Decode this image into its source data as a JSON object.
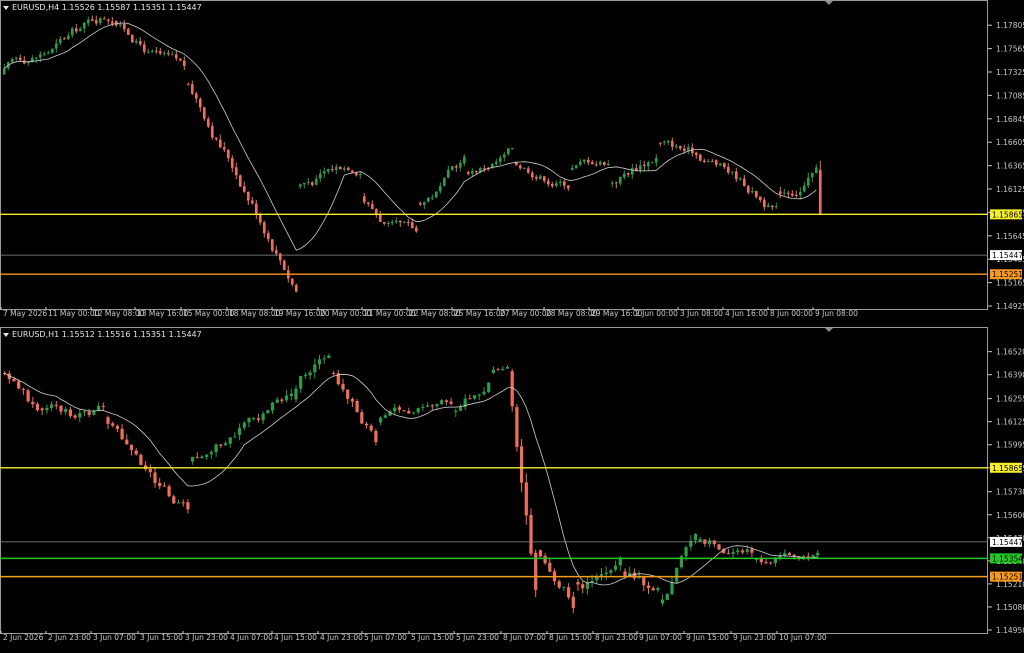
{
  "colors": {
    "bull": "#2e9c4a",
    "bear": "#ef6f5e",
    "ma": "#cfcfcf",
    "yellow_line": "#f5ef2a",
    "orange_line": "#f59a1e",
    "green_line": "#22c822",
    "bid_line": "#8e8e8e",
    "axis": "#c8c8c8"
  },
  "charts": [
    {
      "id": "h4",
      "title": "EURUSD,H4  1.15526 1.15587 1.15351 1.15447",
      "ylim": [
        1.14925,
        1.1792
      ],
      "price_ticks": [
        "1.17805",
        "1.17565",
        "1.17325",
        "1.17085",
        "1.16845",
        "1.16605",
        "1.16365",
        "1.16125",
        "1.15885",
        "1.15645",
        "1.15405",
        "1.15165",
        "1.14925"
      ],
      "time_labels": [
        "7 May 2026",
        "11 May 00:00",
        "12 May 08:00",
        "13 May 16:00",
        "15 May 00:00",
        "18 May 08:00",
        "19 May 16:00",
        "20 May 00:00",
        "21 May 00:00",
        "22 May 08:00",
        "25 May 16:00",
        "27 May 00:00",
        "28 May 08:00",
        "29 May 16:00",
        "2 Jun 00:00",
        "3 Jun 08:00",
        "4 Jun 16:00",
        "8 Jun 00:00",
        "9 Jun 08:00"
      ],
      "levels": [
        {
          "price": 1.15865,
          "label": "1.15865",
          "color": "yellow_line"
        },
        {
          "price": 1.15447,
          "label": "1.15447",
          "color": "bid_line"
        },
        {
          "price": 1.15251,
          "label": "1.15251",
          "color": "orange_line"
        }
      ],
      "chart_data": {
        "type": "candlestick",
        "series": [
          {
            "start": 1.173,
            "count": 28,
            "bias": 0.0002,
            "vol": 0.0011
          },
          {
            "start": 1.1785,
            "count": 18,
            "bias": -0.00032,
            "vol": 0.001
          },
          {
            "start": 1.172,
            "count": 28,
            "bias": -0.0006,
            "vol": 0.0012
          },
          {
            "start": 1.1615,
            "count": 16,
            "bias": 0.0002,
            "vol": 0.001
          },
          {
            "start": 1.1605,
            "count": 14,
            "bias": -0.0004,
            "vol": 0.0011
          },
          {
            "start": 1.1598,
            "count": 12,
            "bias": 0.00032,
            "vol": 0.001
          },
          {
            "start": 1.163,
            "count": 12,
            "bias": 0.0002,
            "vol": 0.0009
          },
          {
            "start": 1.164,
            "count": 14,
            "bias": -4e-05,
            "vol": 0.0009
          },
          {
            "start": 1.1632,
            "count": 10,
            "bias": 0.0001,
            "vol": 0.0009
          },
          {
            "start": 1.1618,
            "count": 12,
            "bias": 0.00035,
            "vol": 0.0013
          },
          {
            "start": 1.166,
            "count": 14,
            "bias": -0.00015,
            "vol": 0.001
          },
          {
            "start": 1.1642,
            "count": 16,
            "bias": -0.0003,
            "vol": 0.001
          },
          {
            "start": 1.161,
            "count": 10,
            "bias": 0.0003,
            "vol": 0.0012
          },
          {
            "start": 1.1632,
            "count": 2,
            "bias": -0.0038,
            "vol": 0.0024
          },
          {
            "start": 1.154,
            "count": 12,
            "bias": 0.00022,
            "vol": 0.0011
          },
          {
            "start": 1.1565,
            "count": 6,
            "bias": -0.00028,
            "vol": 0.0009
          },
          {
            "start": 1.1551,
            "count": 4,
            "bias": -0.0001,
            "vol": 0.0005
          }
        ]
      }
    },
    {
      "id": "h1",
      "title": "EURUSD,H1  1.15512 1.15516 1.15351 1.15447",
      "ylim": [
        1.1495,
        1.1658
      ],
      "price_ticks": [
        "1.16520",
        "1.16390",
        "1.16255",
        "1.16125",
        "1.15995",
        "1.15865",
        "1.15730",
        "1.15600",
        "1.15470",
        "1.15340",
        "1.15210",
        "1.15080",
        "1.14950"
      ],
      "time_labels": [
        "2 Jun 2026",
        "2 Jun 23:00",
        "3 Jun 07:00",
        "3 Jun 15:00",
        "3 Jun 23:00",
        "4 Jun 07:00",
        "4 Jun 15:00",
        "4 Jun 23:00",
        "5 Jun 07:00",
        "5 Jun 15:00",
        "5 Jun 23:00",
        "8 Jun 07:00",
        "8 Jun 15:00",
        "8 Jun 23:00",
        "9 Jun 07:00",
        "9 Jun 15:00",
        "9 Jun 23:00",
        "10 Jun 07:00"
      ],
      "levels": [
        {
          "price": 1.15865,
          "label": "1.15865",
          "color": "yellow_line"
        },
        {
          "price": 1.15447,
          "label": "1.15447",
          "color": "bid_line"
        },
        {
          "price": 1.15354,
          "label": "1.15354",
          "color": "green_line"
        },
        {
          "price": 1.15251,
          "label": "1.15251",
          "color": "orange_line"
        }
      ],
      "chart_data": {
        "type": "candlestick",
        "series": [
          {
            "start": 1.164,
            "count": 8,
            "bias": -0.0003,
            "vol": 0.0007
          },
          {
            "start": 1.162,
            "count": 14,
            "bias": -5e-05,
            "vol": 0.0007
          },
          {
            "start": 1.1615,
            "count": 18,
            "bias": -0.0003,
            "vol": 0.0007
          },
          {
            "start": 1.159,
            "count": 10,
            "bias": 0.0002,
            "vol": 0.0006
          },
          {
            "start": 1.1605,
            "count": 12,
            "bias": 0.0002,
            "vol": 0.0007
          },
          {
            "start": 1.1625,
            "count": 8,
            "bias": 0.00035,
            "vol": 0.0008
          },
          {
            "start": 1.164,
            "count": 10,
            "bias": -0.0003,
            "vol": 0.0007
          },
          {
            "start": 1.1612,
            "count": 16,
            "bias": 5e-05,
            "vol": 0.0005
          },
          {
            "start": 1.1618,
            "count": 8,
            "bias": 0.0003,
            "vol": 0.0007
          },
          {
            "start": 1.164,
            "count": 4,
            "bias": 2e-05,
            "vol": 0.0005
          },
          {
            "start": 1.1641,
            "count": 6,
            "bias": -0.0017,
            "vol": 0.0012
          },
          {
            "start": 1.154,
            "count": 8,
            "bias": -0.0003,
            "vol": 0.0007
          },
          {
            "start": 1.1522,
            "count": 10,
            "bias": 0.00012,
            "vol": 0.0008
          },
          {
            "start": 1.1528,
            "count": 8,
            "bias": -0.0002,
            "vol": 0.0008
          },
          {
            "start": 1.151,
            "count": 8,
            "bias": 0.00045,
            "vol": 0.0008
          },
          {
            "start": 1.1545,
            "count": 12,
            "bias": -8e-05,
            "vol": 0.0006
          },
          {
            "start": 1.1535,
            "count": 14,
            "bias": 3e-05,
            "vol": 0.0005
          },
          {
            "start": 1.154,
            "count": 12,
            "bias": 0.0003,
            "vol": 0.0008
          },
          {
            "start": 1.1575,
            "count": 10,
            "bias": -0.0003,
            "vol": 0.0008
          },
          {
            "start": 1.1545,
            "count": 12,
            "bias": 3e-05,
            "vol": 0.0006
          },
          {
            "start": 1.155,
            "count": 8,
            "bias": 0.00012,
            "vol": 0.0006
          },
          {
            "start": 1.1558,
            "count": 4,
            "bias": -0.0003,
            "vol": 0.0006
          }
        ]
      }
    }
  ]
}
